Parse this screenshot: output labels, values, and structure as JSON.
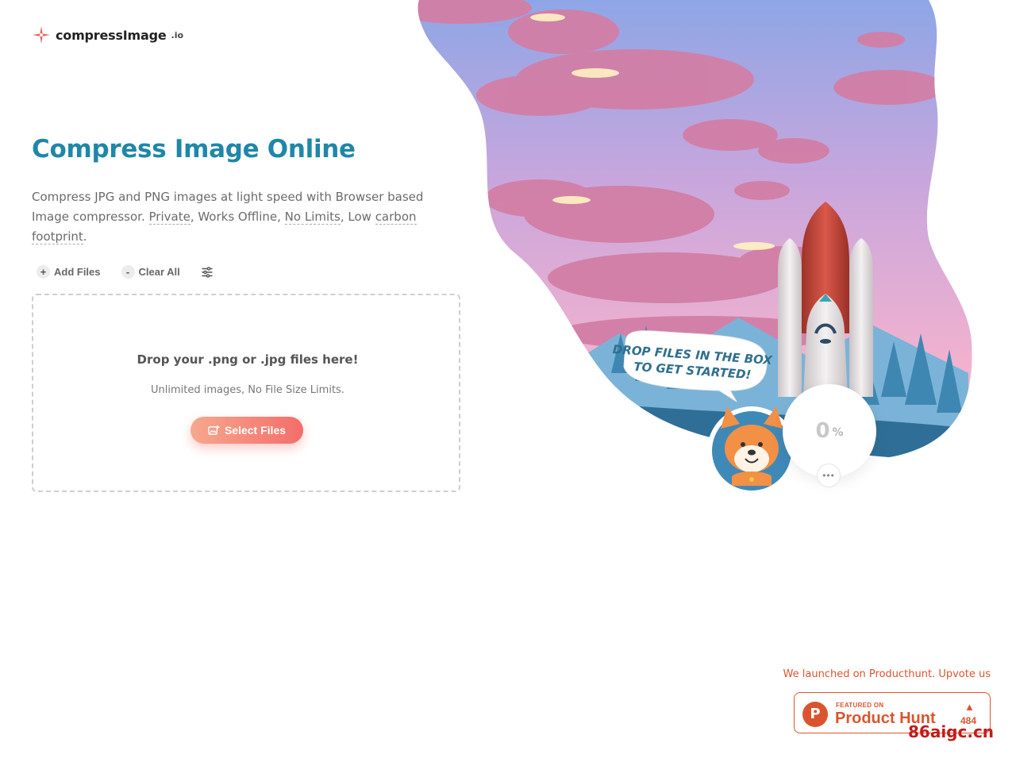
{
  "brand": {
    "name": "compressImage",
    "tld": ".io"
  },
  "hero": {
    "title": "Compress Image Online",
    "subtitle": {
      "lead": "Compress JPG and PNG images at light speed with Browser based Image compressor. ",
      "private": "Private",
      "sep1": ", Works Offline, ",
      "no_limits": "No Limits",
      "sep2": ", Low ",
      "carbon": "carbon footprint",
      "end": "."
    }
  },
  "toolbar": {
    "add_label": "Add Files",
    "add_icon": "+",
    "clear_label": "Clear All",
    "clear_icon": "-",
    "settings_icon": "sliders-icon"
  },
  "dropzone": {
    "title": "Drop your .png or .jpg files here!",
    "subtitle": "Unlimited images, No File Size Limits.",
    "button_label": "Select Files"
  },
  "illustration": {
    "bubble_line1": "DROP FILES IN THE BOX",
    "bubble_line2": "TO GET STARTED!",
    "progress_value": "0",
    "progress_unit": "%",
    "more_icon": "•••"
  },
  "producthunt": {
    "note": "We launched on Producthunt. Upvote us",
    "featured": "FEATURED ON",
    "name": "Product Hunt",
    "count": "484",
    "arrow": "▲",
    "logo_letter": "P"
  },
  "watermark": "86aigc.cn",
  "colors": {
    "title": "#1f87a8",
    "accent": "#f56d6a",
    "producthunt": "#da552f"
  }
}
